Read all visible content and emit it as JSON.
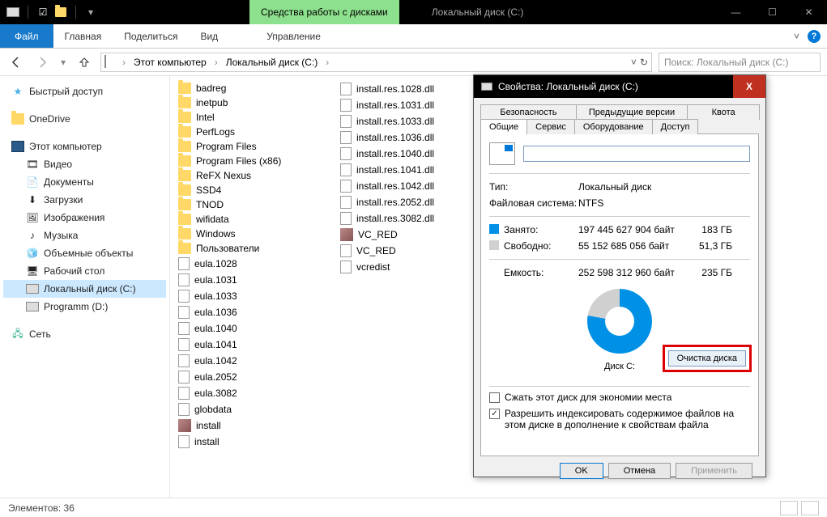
{
  "window": {
    "tool_context": "Средства работы с дисками",
    "title": "Локальный диск (C:)"
  },
  "ribbon": {
    "file": "Файл",
    "tabs": [
      "Главная",
      "Поделиться",
      "Вид"
    ],
    "tool_tab": "Управление"
  },
  "address": {
    "crumbs": [
      "Этот компьютер",
      "Локальный диск (C:)"
    ]
  },
  "search": {
    "placeholder": "Поиск: Локальный диск (C:)"
  },
  "sidebar": {
    "quick": "Быстрый доступ",
    "onedrive": "OneDrive",
    "thispc": "Этот компьютер",
    "pc_items": [
      "Видео",
      "Документы",
      "Загрузки",
      "Изображения",
      "Музыка",
      "Объемные объекты",
      "Рабочий стол",
      "Локальный диск (C:)",
      "Programm (D:)"
    ],
    "network": "Сеть"
  },
  "files": {
    "col1": [
      "badreg",
      "inetpub",
      "Intel",
      "PerfLogs",
      "Program Files",
      "Program Files (x86)",
      "ReFX Nexus",
      "SSD4",
      "TNOD",
      "wifidata",
      "Windows",
      "Пользователи",
      "eula.1028",
      "eula.1031",
      "eula.1033",
      "eula.1036",
      "eula.1040",
      "eula.1041",
      "eula.1042",
      "eula.2052",
      "eula.3082",
      "globdata",
      "install",
      "install"
    ],
    "col1_types": [
      "f",
      "f",
      "f",
      "f",
      "f",
      "f",
      "f",
      "f",
      "f",
      "f",
      "f",
      "f",
      "d",
      "d",
      "d",
      "d",
      "d",
      "d",
      "d",
      "d",
      "d",
      "d",
      "e",
      "d"
    ],
    "col2": [
      "install.res.1028.dll",
      "install.res.1031.dll",
      "install.res.1033.dll",
      "install.res.1036.dll",
      "install.res.1040.dll",
      "install.res.1041.dll",
      "install.res.1042.dll",
      "install.res.2052.dll",
      "install.res.3082.dll",
      "VC_RED",
      "VC_RED",
      "vcredist"
    ],
    "col2_types": [
      "d",
      "d",
      "d",
      "d",
      "d",
      "d",
      "d",
      "d",
      "d",
      "e",
      "d",
      "d"
    ]
  },
  "status": {
    "text": "Элементов: 36"
  },
  "dialog": {
    "title": "Свойства: Локальный диск (C:)",
    "tabs_row1": [
      "Безопасность",
      "Предыдущие версии",
      "Квота"
    ],
    "tabs_row2": [
      "Общие",
      "Сервис",
      "Оборудование",
      "Доступ"
    ],
    "active_tab": "Общие",
    "drive_name": "",
    "type_label": "Тип:",
    "type_value": "Локальный диск",
    "fs_label": "Файловая система:",
    "fs_value": "NTFS",
    "used_label": "Занято:",
    "used_bytes": "197 445 627 904 байт",
    "used_gb": "183 ГБ",
    "free_label": "Свободно:",
    "free_bytes": "55 152 685 056 байт",
    "free_gb": "51,3 ГБ",
    "cap_label": "Емкость:",
    "cap_bytes": "252 598 312 960 байт",
    "cap_gb": "235 ГБ",
    "disk_label": "Диск C:",
    "cleanup": "Очистка диска",
    "compress": "Сжать этот диск для экономии места",
    "index": "Разрешить индексировать содержимое файлов на этом диске в дополнение к свойствам файла",
    "ok": "OK",
    "cancel": "Отмена",
    "apply": "Применить"
  }
}
